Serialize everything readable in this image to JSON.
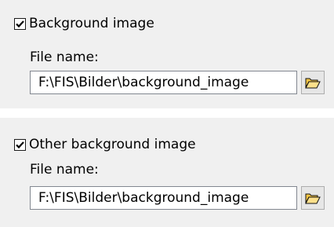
{
  "section_1": {
    "checkbox_label": "Background image",
    "checked": true,
    "file_label": "File name:",
    "file_value": "F:\\FIS\\Bilder\\background_image",
    "browse_icon": "folder-open-icon"
  },
  "section_2": {
    "checkbox_label": "Other background image",
    "checked": true,
    "file_label": "File name:",
    "file_value": "F:\\FIS\\Bilder\\background_image",
    "browse_icon": "folder-open-icon"
  },
  "colors": {
    "panel_bg": "#f0f0f0",
    "folder_icon": "#f5c542"
  }
}
